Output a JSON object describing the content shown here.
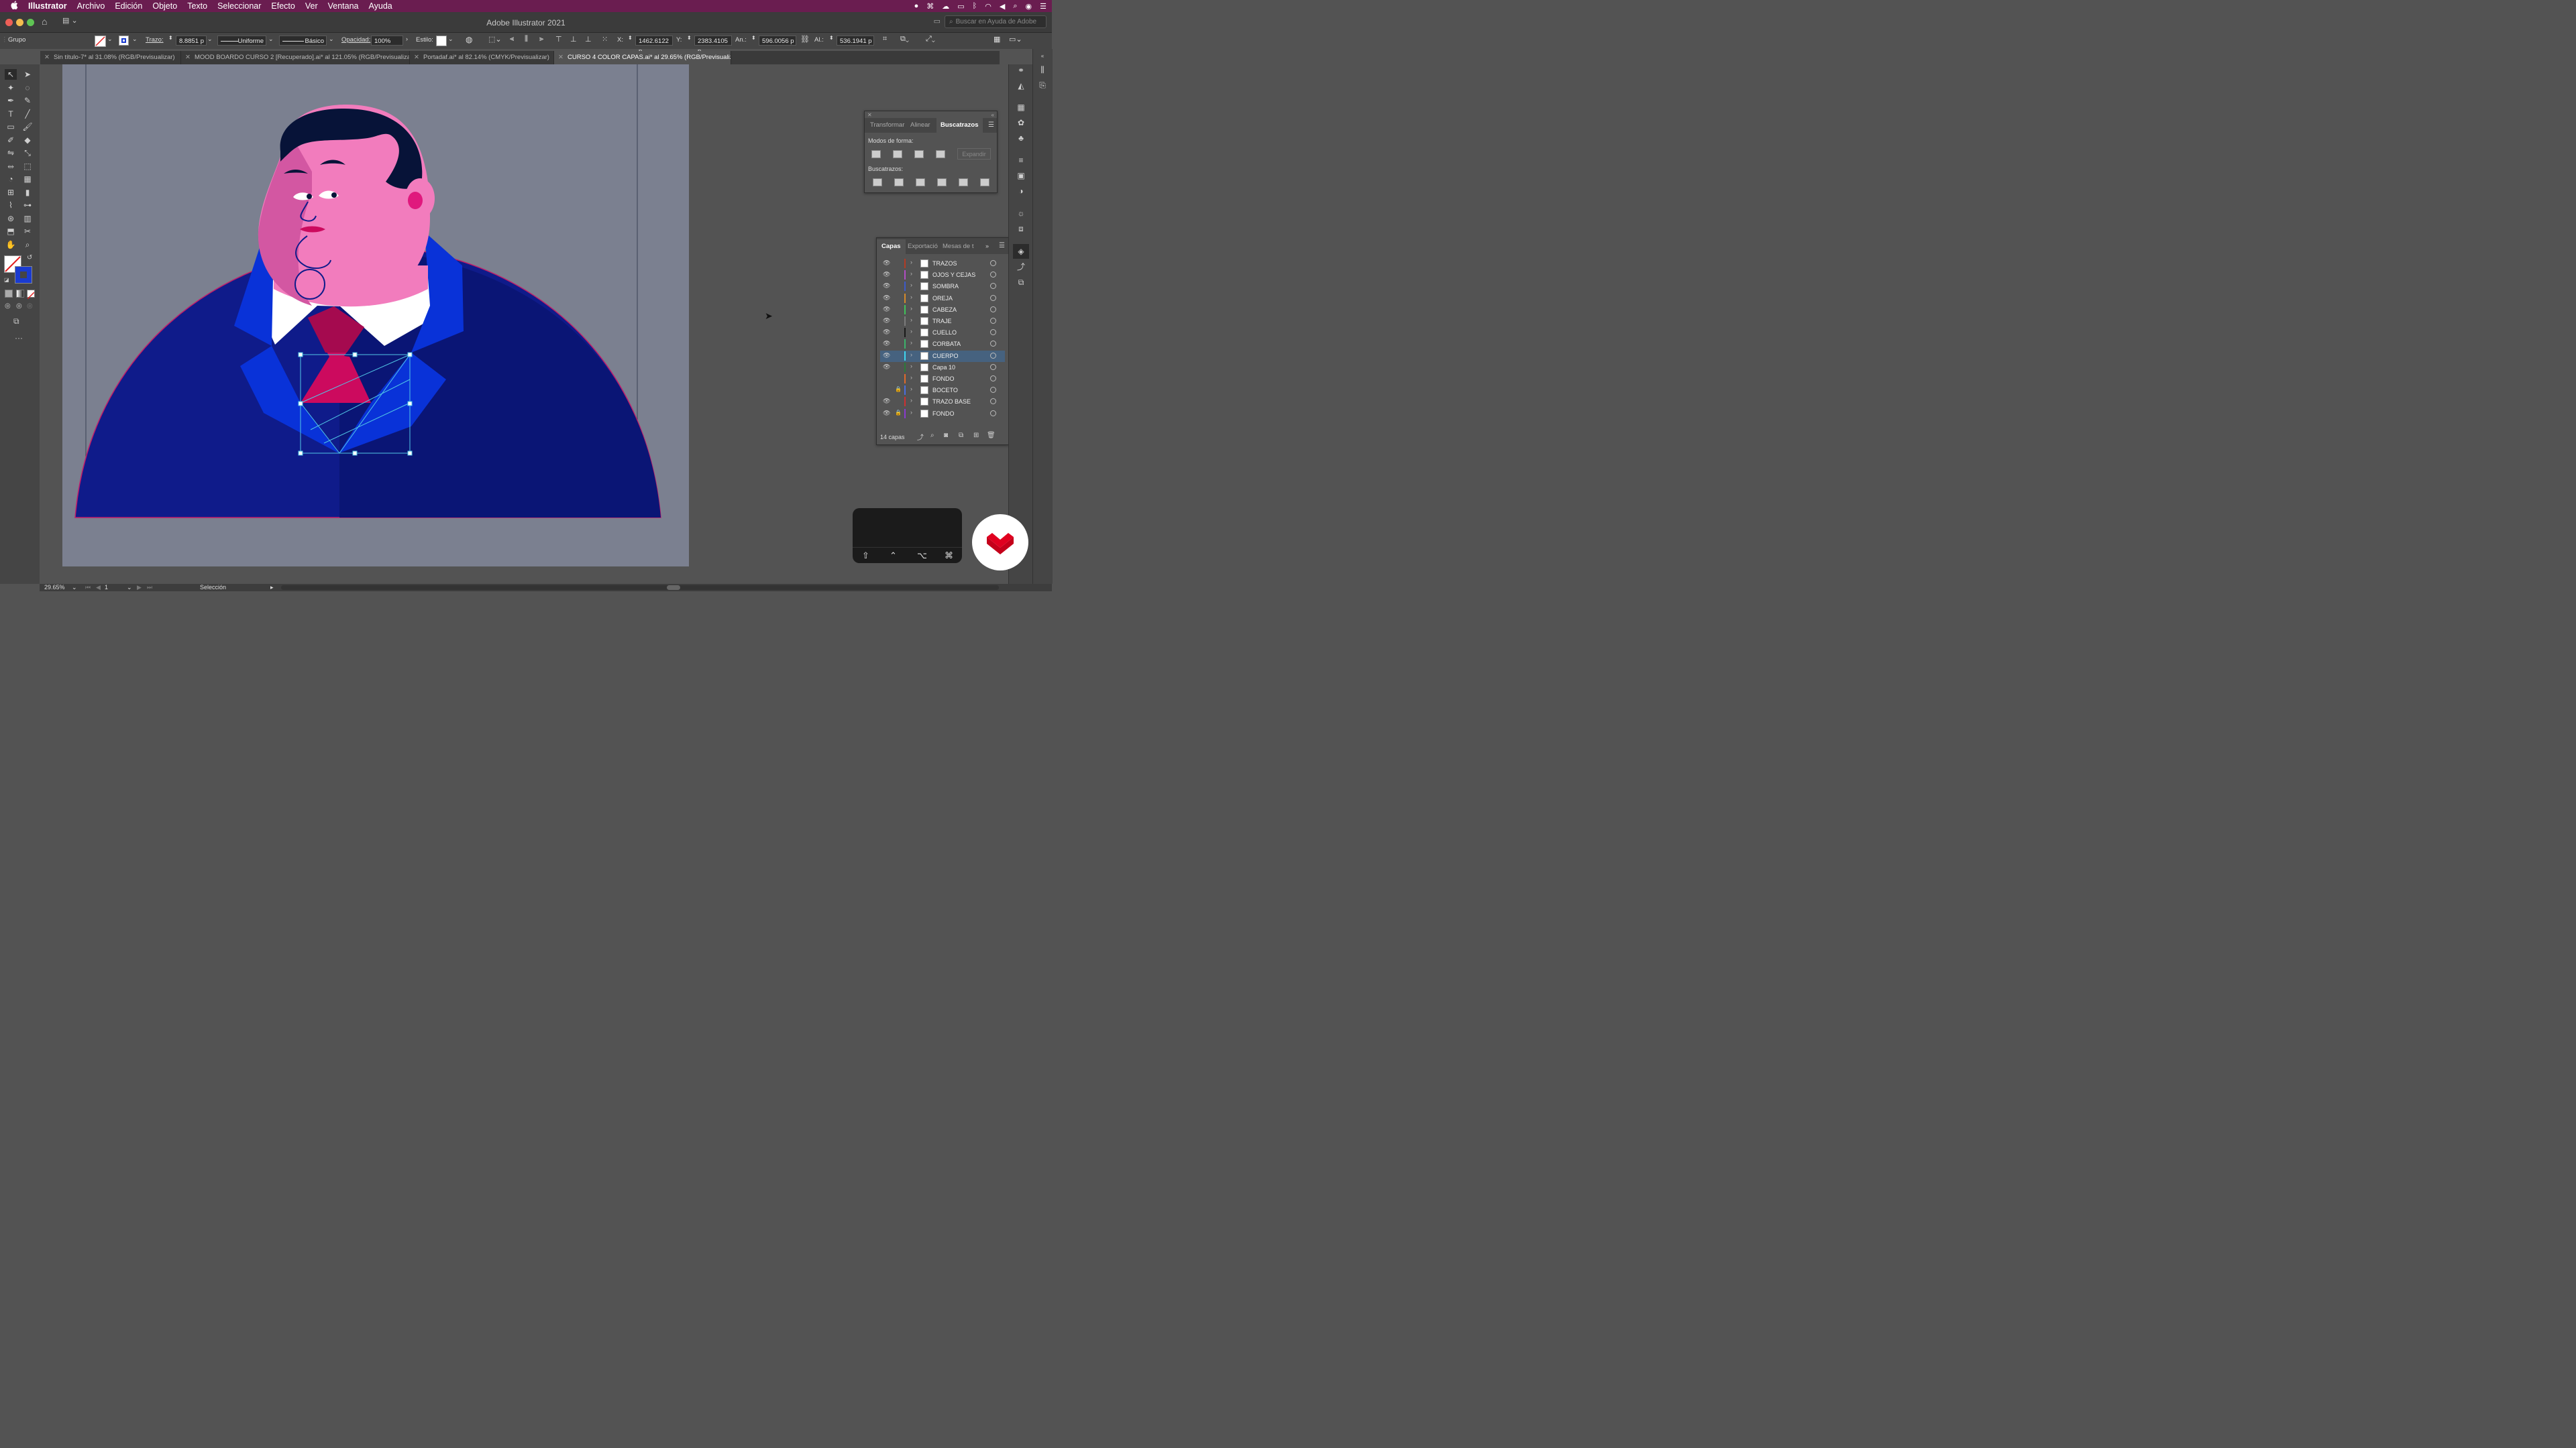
{
  "menubar": {
    "apple": "",
    "items": [
      "Illustrator",
      "Archivo",
      "Edición",
      "Objeto",
      "Texto",
      "Seleccionar",
      "Efecto",
      "Ver",
      "Ventana",
      "Ayuda"
    ]
  },
  "window": {
    "title": "Adobe Illustrator 2021",
    "search_placeholder": "Buscar en Ayuda de Adobe"
  },
  "control": {
    "selection_type": "Grupo",
    "stroke_label": "Trazo:",
    "stroke_value": "8.8851 p",
    "profile": "Uniforme",
    "brush": "Básico",
    "opacity_label": "Opacidad:",
    "opacity_value": "100%",
    "style_label": "Estilo:",
    "x_label": "X:",
    "x_value": "1462.6122 p",
    "y_label": "Y:",
    "y_value": "2383.4105 p",
    "w_label": "An.:",
    "w_value": "596.0056 p",
    "h_label": "Al.:",
    "h_value": "536.1941 p"
  },
  "tabs": [
    {
      "label": "Sin título-7* al 31.08% (RGB/Previsualizar)"
    },
    {
      "label": "MOOD BOARDO CURSO 2 [Recuperado].ai* al 121.05% (RGB/Previsualizar)"
    },
    {
      "label": "Portadaf.ai* al 82.14% (CMYK/Previsualizar)"
    },
    {
      "label": "CURSO 4 COLOR CAPAS.ai* al 29.65% (RGB/Previsualizar)",
      "active": true
    }
  ],
  "pathfinder": {
    "tabs": [
      "Transformar",
      "Alinear",
      "Buscatrazos"
    ],
    "active_tab": "Buscatrazos",
    "shape_modes_label": "Modos de forma:",
    "expand_label": "Expandir",
    "pathfinders_label": "Buscatrazos:"
  },
  "layers": {
    "tabs": [
      "Capas",
      "Exportació",
      "Mesas de t"
    ],
    "count_label": "14 capas",
    "items": [
      {
        "name": "TRAZOS",
        "color": "#b33b24",
        "visible": true,
        "locked": false
      },
      {
        "name": "OJOS Y CEJAS",
        "color": "#b14dc4",
        "visible": true,
        "locked": false
      },
      {
        "name": "SOMBRA",
        "color": "#3d5ac9",
        "visible": true,
        "locked": false
      },
      {
        "name": "OREJA",
        "color": "#d58a2a",
        "visible": true,
        "locked": false
      },
      {
        "name": "CABEZA",
        "color": "#3fc45a",
        "visible": true,
        "locked": false
      },
      {
        "name": "TRAJE",
        "color": "#7b7b7b",
        "visible": true,
        "locked": false
      },
      {
        "name": "CUELLO",
        "color": "#1a1a1a",
        "visible": true,
        "locked": false
      },
      {
        "name": "CORBATA",
        "color": "#3cb36b",
        "visible": true,
        "locked": false
      },
      {
        "name": "CUERPO",
        "color": "#3fd6f0",
        "visible": true,
        "locked": false,
        "selected": true
      },
      {
        "name": "Capa 10",
        "color": "#2c7a3a",
        "visible": true,
        "locked": false
      },
      {
        "name": "FONDO",
        "color": "#e06a2a",
        "visible": false,
        "locked": false
      },
      {
        "name": "BOCETO",
        "color": "#4a6ee0",
        "visible": false,
        "locked": true
      },
      {
        "name": "TRAZO BASE",
        "color": "#d03030",
        "visible": true,
        "locked": false
      },
      {
        "name": "FONDO",
        "color": "#8a3ad0",
        "visible": true,
        "locked": true
      }
    ]
  },
  "status": {
    "zoom": "29.65%",
    "artboard_num": "1",
    "tool": "Selección"
  },
  "colors": {
    "menubar": "#6a1d50",
    "artboard_bg": "#7b8090",
    "suit_dark": "#0f1b8a",
    "suit_light": "#0932d8",
    "skin": "#f27cbd",
    "skin_shadow": "#d357a2",
    "hair": "#071338",
    "tie": "#cc0a5e",
    "selection": "#51c7e6"
  }
}
